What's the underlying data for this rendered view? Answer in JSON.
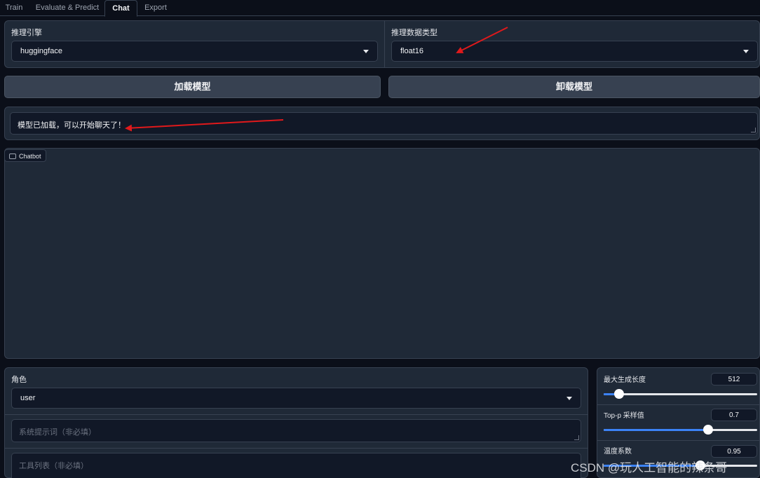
{
  "tabs": [
    "Train",
    "Evaluate & Predict",
    "Chat",
    "Export"
  ],
  "active_tab": "Chat",
  "engine": {
    "label": "推理引擎",
    "value": "huggingface"
  },
  "dtype": {
    "label": "推理数据类型",
    "value": "float16"
  },
  "buttons": {
    "load": "加载模型",
    "unload": "卸载模型"
  },
  "info_box": {
    "value": "模型已加载，可以开始聊天了！"
  },
  "chatbot": {
    "label": "Chatbot"
  },
  "role": {
    "label": "角色",
    "value": "user"
  },
  "system_prompt": {
    "placeholder": "系统提示词（非必填）"
  },
  "tools": {
    "placeholder": "工具列表（非必填）"
  },
  "params": [
    {
      "label": "最大生成长度",
      "value": "512",
      "fraction": 0.1
    },
    {
      "label": "Top-p 采样值",
      "value": "0.7",
      "fraction": 0.68
    },
    {
      "label": "温度系数",
      "value": "0.95",
      "fraction": 0.63
    }
  ],
  "annotations": {
    "arrow_color": "#e0191b"
  },
  "watermark": "CSDN @玩人工智能的辣条哥"
}
